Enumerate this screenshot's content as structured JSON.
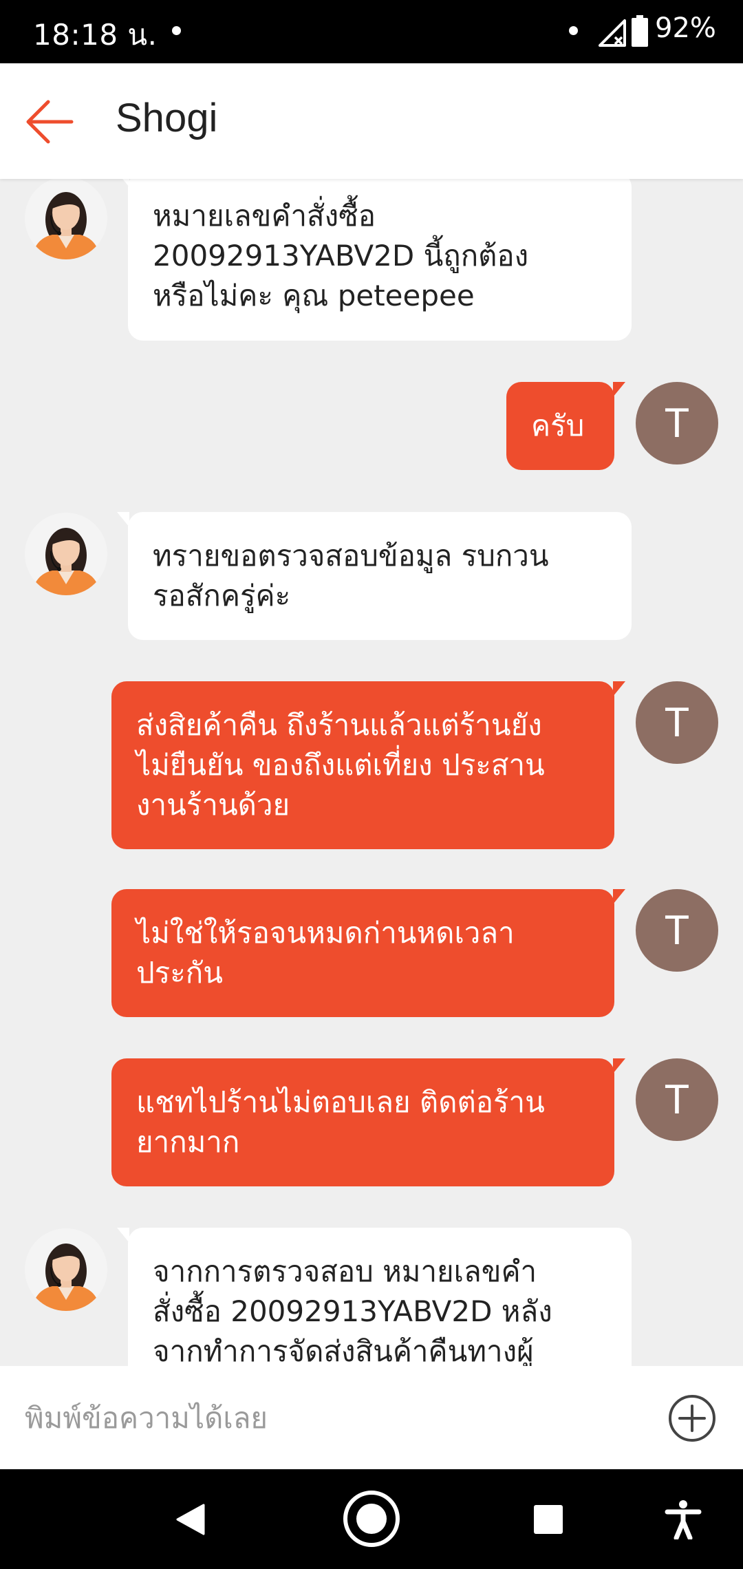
{
  "status_bar": {
    "time": "18:18 น.",
    "battery_percent": "92%"
  },
  "header": {
    "title": "Shogi"
  },
  "chat": {
    "user_avatar_letter": "T",
    "messages": [
      {
        "sender": "agent",
        "text": "หมายเลขคำสั่งซื้อ\n20092913YABV2D นี้ถูกต้อง\nหรือไม่คะ คุณ peteepee"
      },
      {
        "sender": "user",
        "text": "ครับ"
      },
      {
        "sender": "agent",
        "text": "ทรายขอตรวจสอบข้อมูล รบกวน\nรอสักครู่ค่ะ"
      },
      {
        "sender": "user",
        "text": "ส่งสิยค้าคืน ถึงร้านแล้วแต่ร้านยัง\nไม่ยืนยัน ของถึงแต่เที่ยง ประสาน\nงานร้านด้วย"
      },
      {
        "sender": "user",
        "text": "ไม่ใช่ให้รอจนหมดก่านหดเวลา\nประกัน"
      },
      {
        "sender": "user",
        "text": "แชทไปร้านไม่ตอบเลย ติดต่อร้าน\nยากมาก"
      },
      {
        "sender": "agent",
        "text": "จากการตรวจสอบ หมายเลขคำ\nสั่งซื้อ 20092913YABV2D หลัง\nจากทำการจัดส่งสินค้าคืนทางผู้"
      }
    ]
  },
  "composer": {
    "placeholder": "พิมพ์ข้อความได้เลย"
  },
  "colors": {
    "accent": "#ee4d2d",
    "user_avatar": "#8d6e63",
    "chat_background": "#efefef"
  },
  "icons": {
    "back": "arrow-left-icon",
    "add": "plus-circle-icon",
    "nav": [
      "triangle-back-icon",
      "circle-home-icon",
      "square-recents-icon",
      "accessibility-icon"
    ]
  }
}
